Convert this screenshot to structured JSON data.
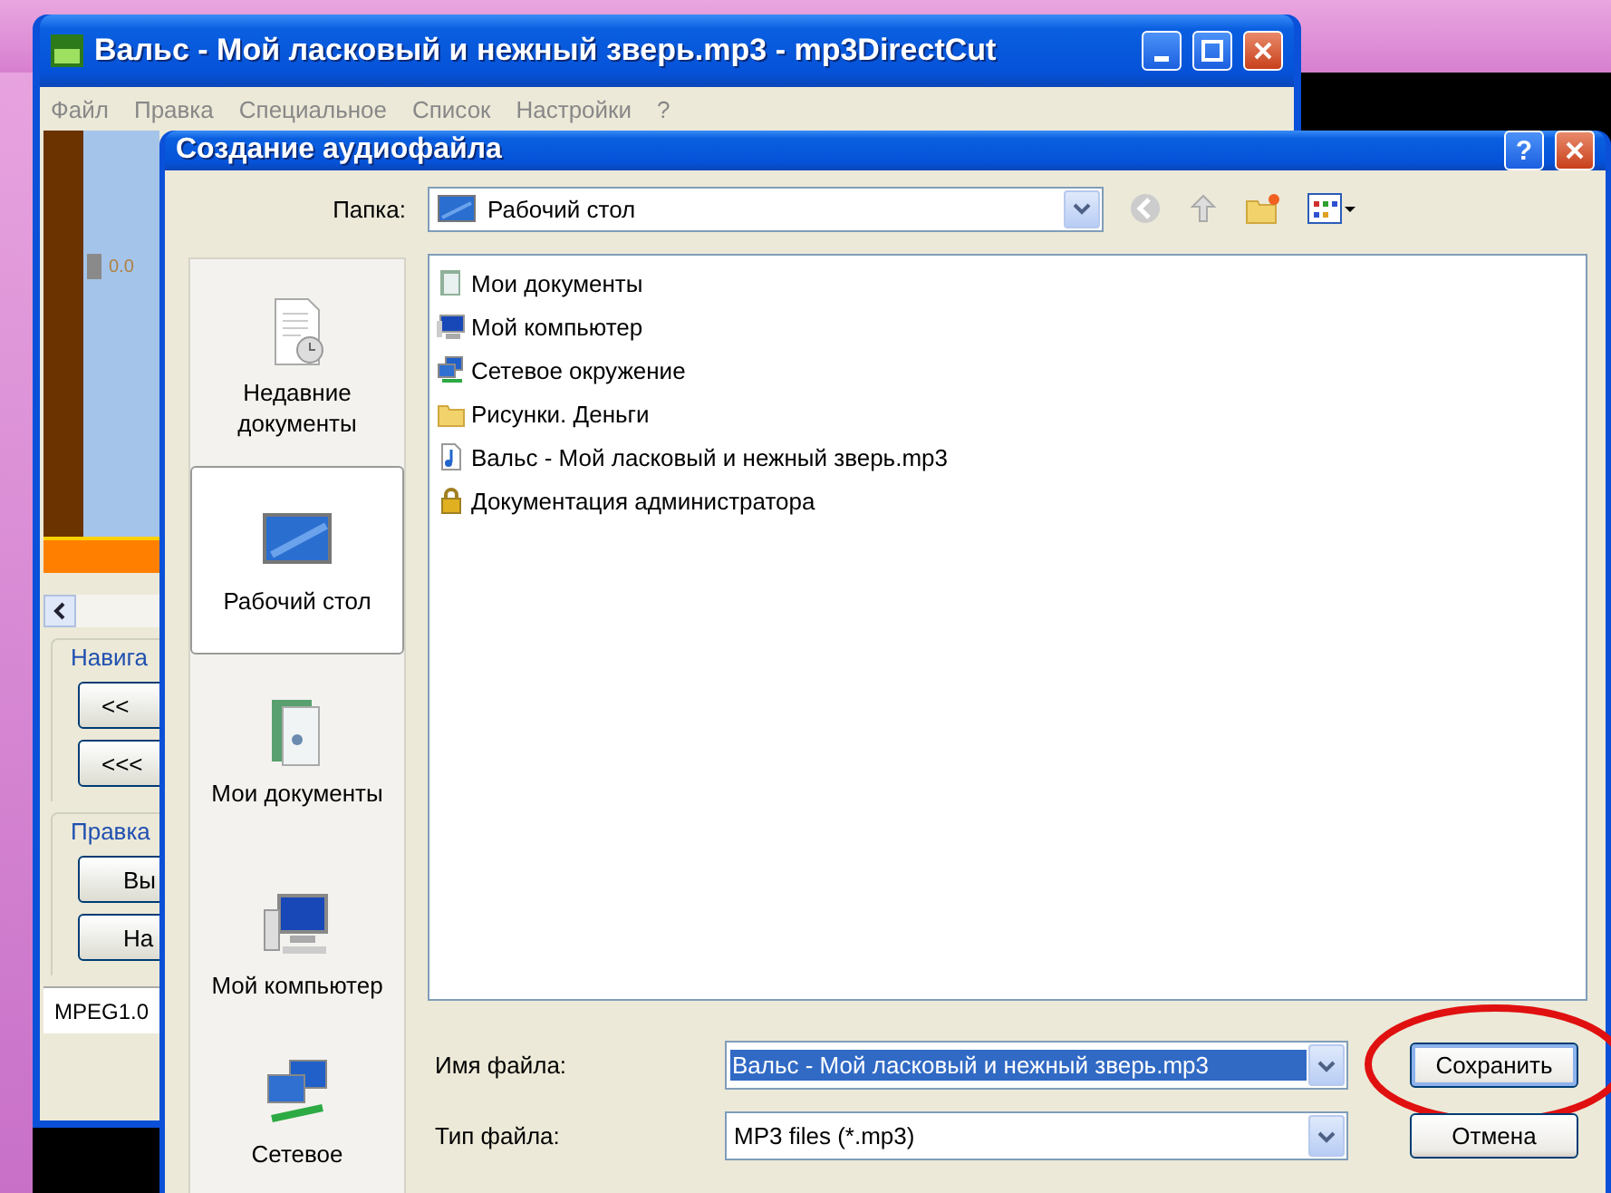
{
  "main_window": {
    "title": "Вальс - Мой ласковый и нежный зверь.mp3 - mp3DirectCut",
    "menu": [
      "Файл",
      "Правка",
      "Специальное",
      "Список",
      "Настройки",
      "?"
    ],
    "marker_reading": "0.0",
    "nav_group": "Навига",
    "nav_buttons": [
      "<<",
      "<<<"
    ],
    "edit_group": "Правка",
    "edit_buttons": [
      "Вы",
      "На"
    ],
    "status": "MPEG1.0"
  },
  "dialog": {
    "title": "Создание аудиофайла",
    "help_glyph": "?",
    "folder_label": "Папка:",
    "folder": "Рабочий стол",
    "places": [
      {
        "label": "Недавние документы",
        "kind": "recent",
        "selected": false
      },
      {
        "label": "Рабочий стол",
        "kind": "desktop",
        "selected": true
      },
      {
        "label": "Мои документы",
        "kind": "documents",
        "selected": false
      },
      {
        "label": "Мой компьютер",
        "kind": "computer",
        "selected": false
      },
      {
        "label": "Сетевое",
        "kind": "network",
        "selected": false
      }
    ],
    "files": [
      {
        "name": "Мои документы",
        "kind": "documents"
      },
      {
        "name": "Мой компьютер",
        "kind": "computer"
      },
      {
        "name": "Сетевое окружение",
        "kind": "network"
      },
      {
        "name": "Рисунки. Деньги",
        "kind": "folder"
      },
      {
        "name": "Вальс - Мой ласковый и нежный зверь.mp3",
        "kind": "audio"
      },
      {
        "name": "Документация администратора",
        "kind": "locked"
      }
    ],
    "filename_label": "Имя файла:",
    "filename": "Вальс - Мой ласковый и нежный зверь.mp3",
    "filetype_label": "Тип файла:",
    "filetype": "MP3 files (*.mp3)",
    "buttons": [
      {
        "label": "Сохранить",
        "kind": "save",
        "highlighted": true
      },
      {
        "label": "Отмена",
        "kind": "cancel",
        "highlighted": false
      }
    ]
  }
}
